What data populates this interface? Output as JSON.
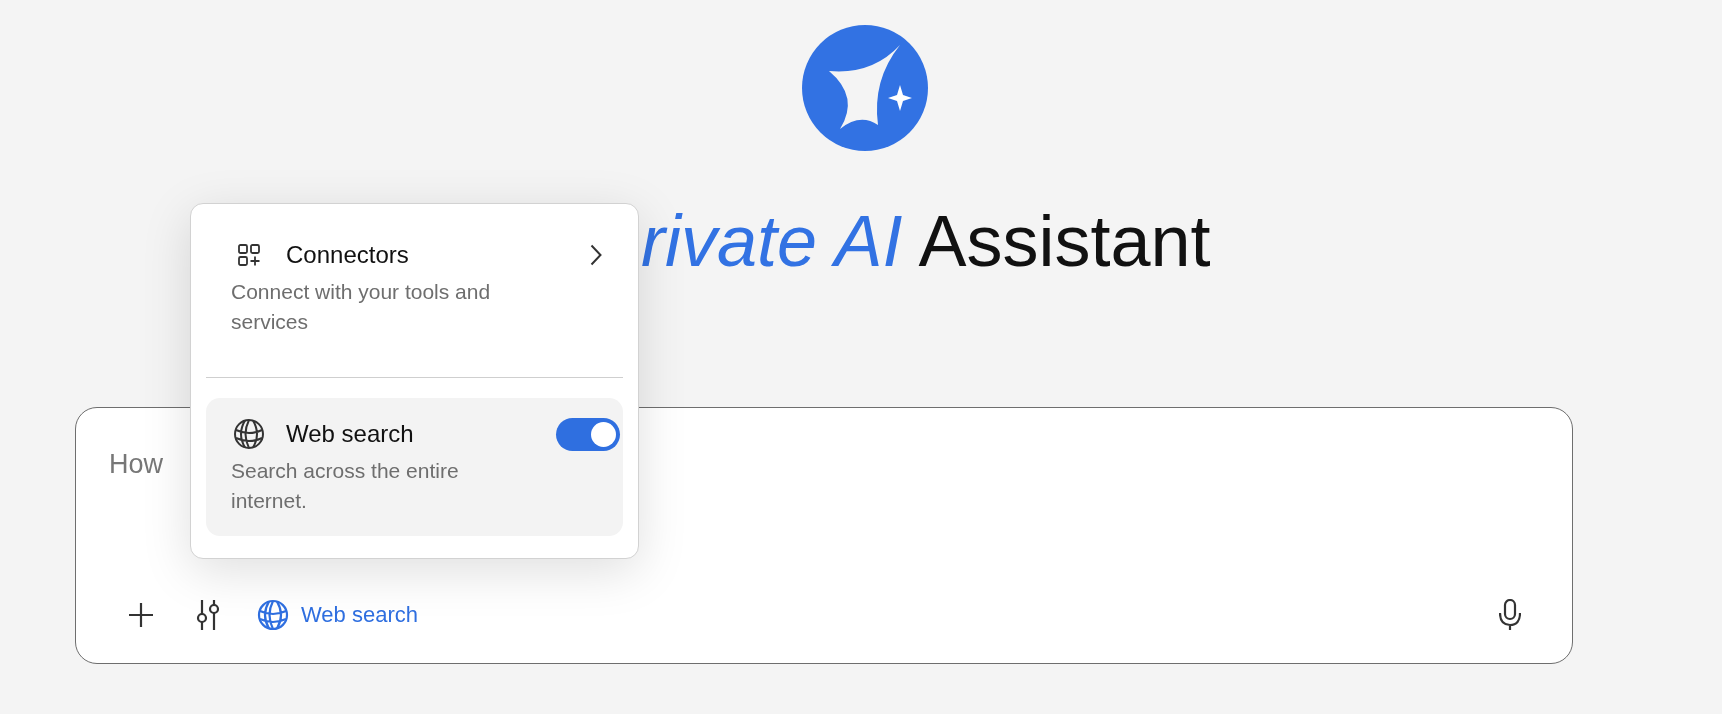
{
  "heading": "*rivate AI* Assistant",
  "composer": {
    "placeholder": "How",
    "chip": {
      "label": "Web search",
      "active": true
    }
  },
  "menu": {
    "items": [
      {
        "kind": "submenu",
        "title": "Connectors",
        "description": "Connect with your tools and services",
        "highlighted": false
      },
      {
        "kind": "toggle",
        "title": "Web search",
        "description": "Search across the entire internet.",
        "on": true,
        "highlighted": true
      }
    ]
  }
}
